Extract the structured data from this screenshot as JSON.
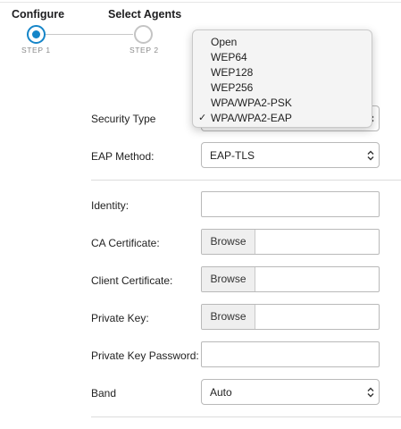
{
  "stepper": {
    "steps": [
      {
        "title": "Configure",
        "sub": "STEP 1",
        "state": "active"
      },
      {
        "title": "Select Agents",
        "sub": "STEP 2",
        "state": "inactive"
      }
    ],
    "accent_color": "#1585c8"
  },
  "form": {
    "security_type": {
      "label": "Security Type"
    },
    "eap_method": {
      "label": "EAP Method:",
      "value": "EAP-TLS"
    },
    "identity": {
      "label": "Identity:",
      "value": ""
    },
    "ca_certificate": {
      "label": "CA Certificate:",
      "button": "Browse"
    },
    "client_certificate": {
      "label": "Client Certificate:",
      "button": "Browse"
    },
    "private_key": {
      "label": "Private Key:",
      "button": "Browse"
    },
    "private_key_password": {
      "label": "Private Key Password:",
      "value": ""
    },
    "band": {
      "label": "Band",
      "value": "Auto"
    }
  },
  "security_dropdown": {
    "options": [
      "Open",
      "WEP64",
      "WEP128",
      "WEP256",
      "WPA/WPA2-PSK",
      "WPA/WPA2-EAP"
    ],
    "selected": "WPA/WPA2-EAP",
    "check_mark": "✓"
  }
}
